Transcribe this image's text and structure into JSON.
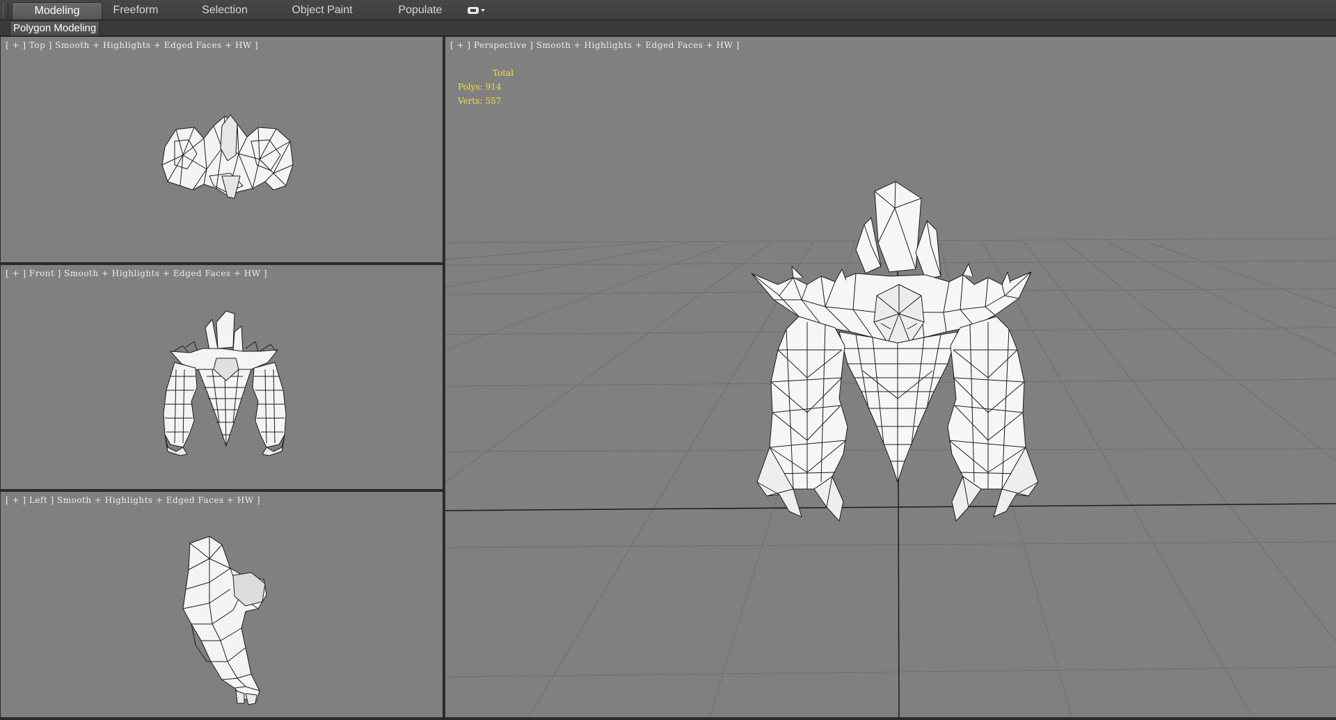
{
  "ribbon": {
    "tabs": [
      {
        "label": "Modeling",
        "active": true
      },
      {
        "label": "Freeform",
        "active": false
      },
      {
        "label": "Selection",
        "active": false
      },
      {
        "label": "Object Paint",
        "active": false
      },
      {
        "label": "Populate",
        "active": false
      }
    ],
    "panel_button": "Polygon Modeling"
  },
  "viewports": {
    "top": {
      "label": "[ + ] Top ] Smooth + Highlights + Edged Faces + HW ]"
    },
    "front": {
      "label": "[ + ] Front ] Smooth + Highlights + Edged Faces + HW ]"
    },
    "left": {
      "label": "[ + ] Left ] Smooth + Highlights + Edged Faces + HW ]"
    },
    "perspective": {
      "label": "[ + ] Perspective ] Smooth + Highlights + Edged Faces + HW ]"
    }
  },
  "stats": {
    "total_label": "Total",
    "polys_label": "Polys:",
    "polys_value": "914",
    "verts_label": "Verts:",
    "verts_value": "557"
  },
  "colors": {
    "viewport_bg": "#808080",
    "stats_text": "#f3e23a",
    "label_text": "#ececec",
    "mesh_fill": "#f4f4f4",
    "mesh_edge": "#1a1a1a"
  }
}
